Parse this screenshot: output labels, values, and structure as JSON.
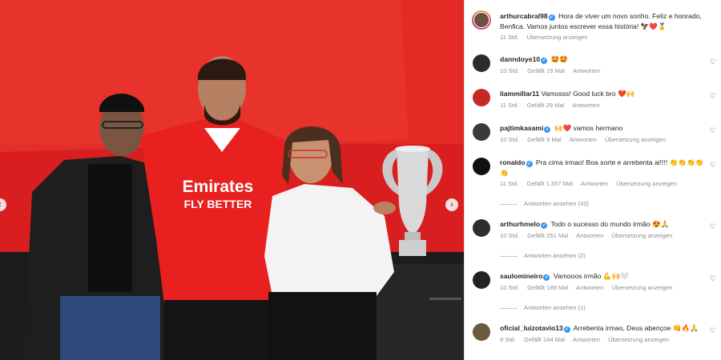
{
  "post": {
    "image_alt": "Photo of a family posing with a Benfica jersey in front of a trophy",
    "jersey": {
      "sponsor_line1": "Emirates",
      "sponsor_line2": "FLY BETTER"
    },
    "nav_prev_icon": "chevron-left-icon",
    "nav_next_icon": "chevron-right-icon"
  },
  "caption": {
    "username": "arthurcabral98",
    "text": "Hora de viver um novo sonho. Feliz e honrado, Benfica. Vamos juntos escrever essa história! 🦅❤️🥇",
    "time": "11 Std.",
    "translate": "Übersetzung anzeigen"
  },
  "comments": [
    {
      "username": "danndoye10",
      "verified": true,
      "text": "🤩🤩",
      "time": "10 Std.",
      "likes": "Gefällt 15 Mal",
      "reply": "Antworten",
      "translate": "",
      "view_replies": ""
    },
    {
      "username": "liammillar11",
      "verified": false,
      "text": "Vamosss! Good luck bro ❤️🙌",
      "time": "11 Std.",
      "likes": "Gefällt 29 Mal",
      "reply": "Antworten",
      "translate": "",
      "view_replies": ""
    },
    {
      "username": "pajtimkasami",
      "verified": true,
      "text": "🙌❤️ vamos hermano",
      "time": "10 Std.",
      "likes": "Gefällt 9 Mal",
      "reply": "Antworten",
      "translate": "Übersetzung anzeigen",
      "view_replies": ""
    },
    {
      "username": "ronaldo",
      "verified": true,
      "text": "Pra cima irmao! Boa sorte e arrebenta ai!!!! 👏👏👏👏👏",
      "time": "11 Std.",
      "likes": "Gefällt 1.357 Mal",
      "reply": "Antworten",
      "translate": "Übersetzung anzeigen",
      "view_replies": "Antworten ansehen (43)"
    },
    {
      "username": "arthurhmelo",
      "verified": true,
      "text": "Todo o sucesso do mundo irmão 😍🙏",
      "time": "10 Std.",
      "likes": "Gefällt 251 Mal",
      "reply": "Antworten",
      "translate": "Übersetzung anzeigen",
      "view_replies": "Antworten ansehen (2)"
    },
    {
      "username": "saulomineiro",
      "verified": true,
      "text": "Vamooos irmão 💪🙌🤍",
      "time": "10 Std.",
      "likes": "Gefällt 189 Mal",
      "reply": "Antworten",
      "translate": "Übersetzung anzeigen",
      "view_replies": "Antworten ansehen (1)"
    },
    {
      "username": "oficial_luizotavio13",
      "verified": true,
      "text": "Arrebenta irmao, Deus abençoe 👊🔥🙏",
      "time": "9 Std.",
      "likes": "Gefällt 144 Mal",
      "reply": "Antworten",
      "translate": "Übersetzung anzeigen",
      "view_replies": ""
    }
  ],
  "colors": {
    "benfica_red": "#e8201f",
    "verified_blue": "#3897f0",
    "muted_text": "#8e8e8e"
  },
  "icons": {
    "like": "heart-outline-icon",
    "verified": "verified-badge-icon"
  }
}
